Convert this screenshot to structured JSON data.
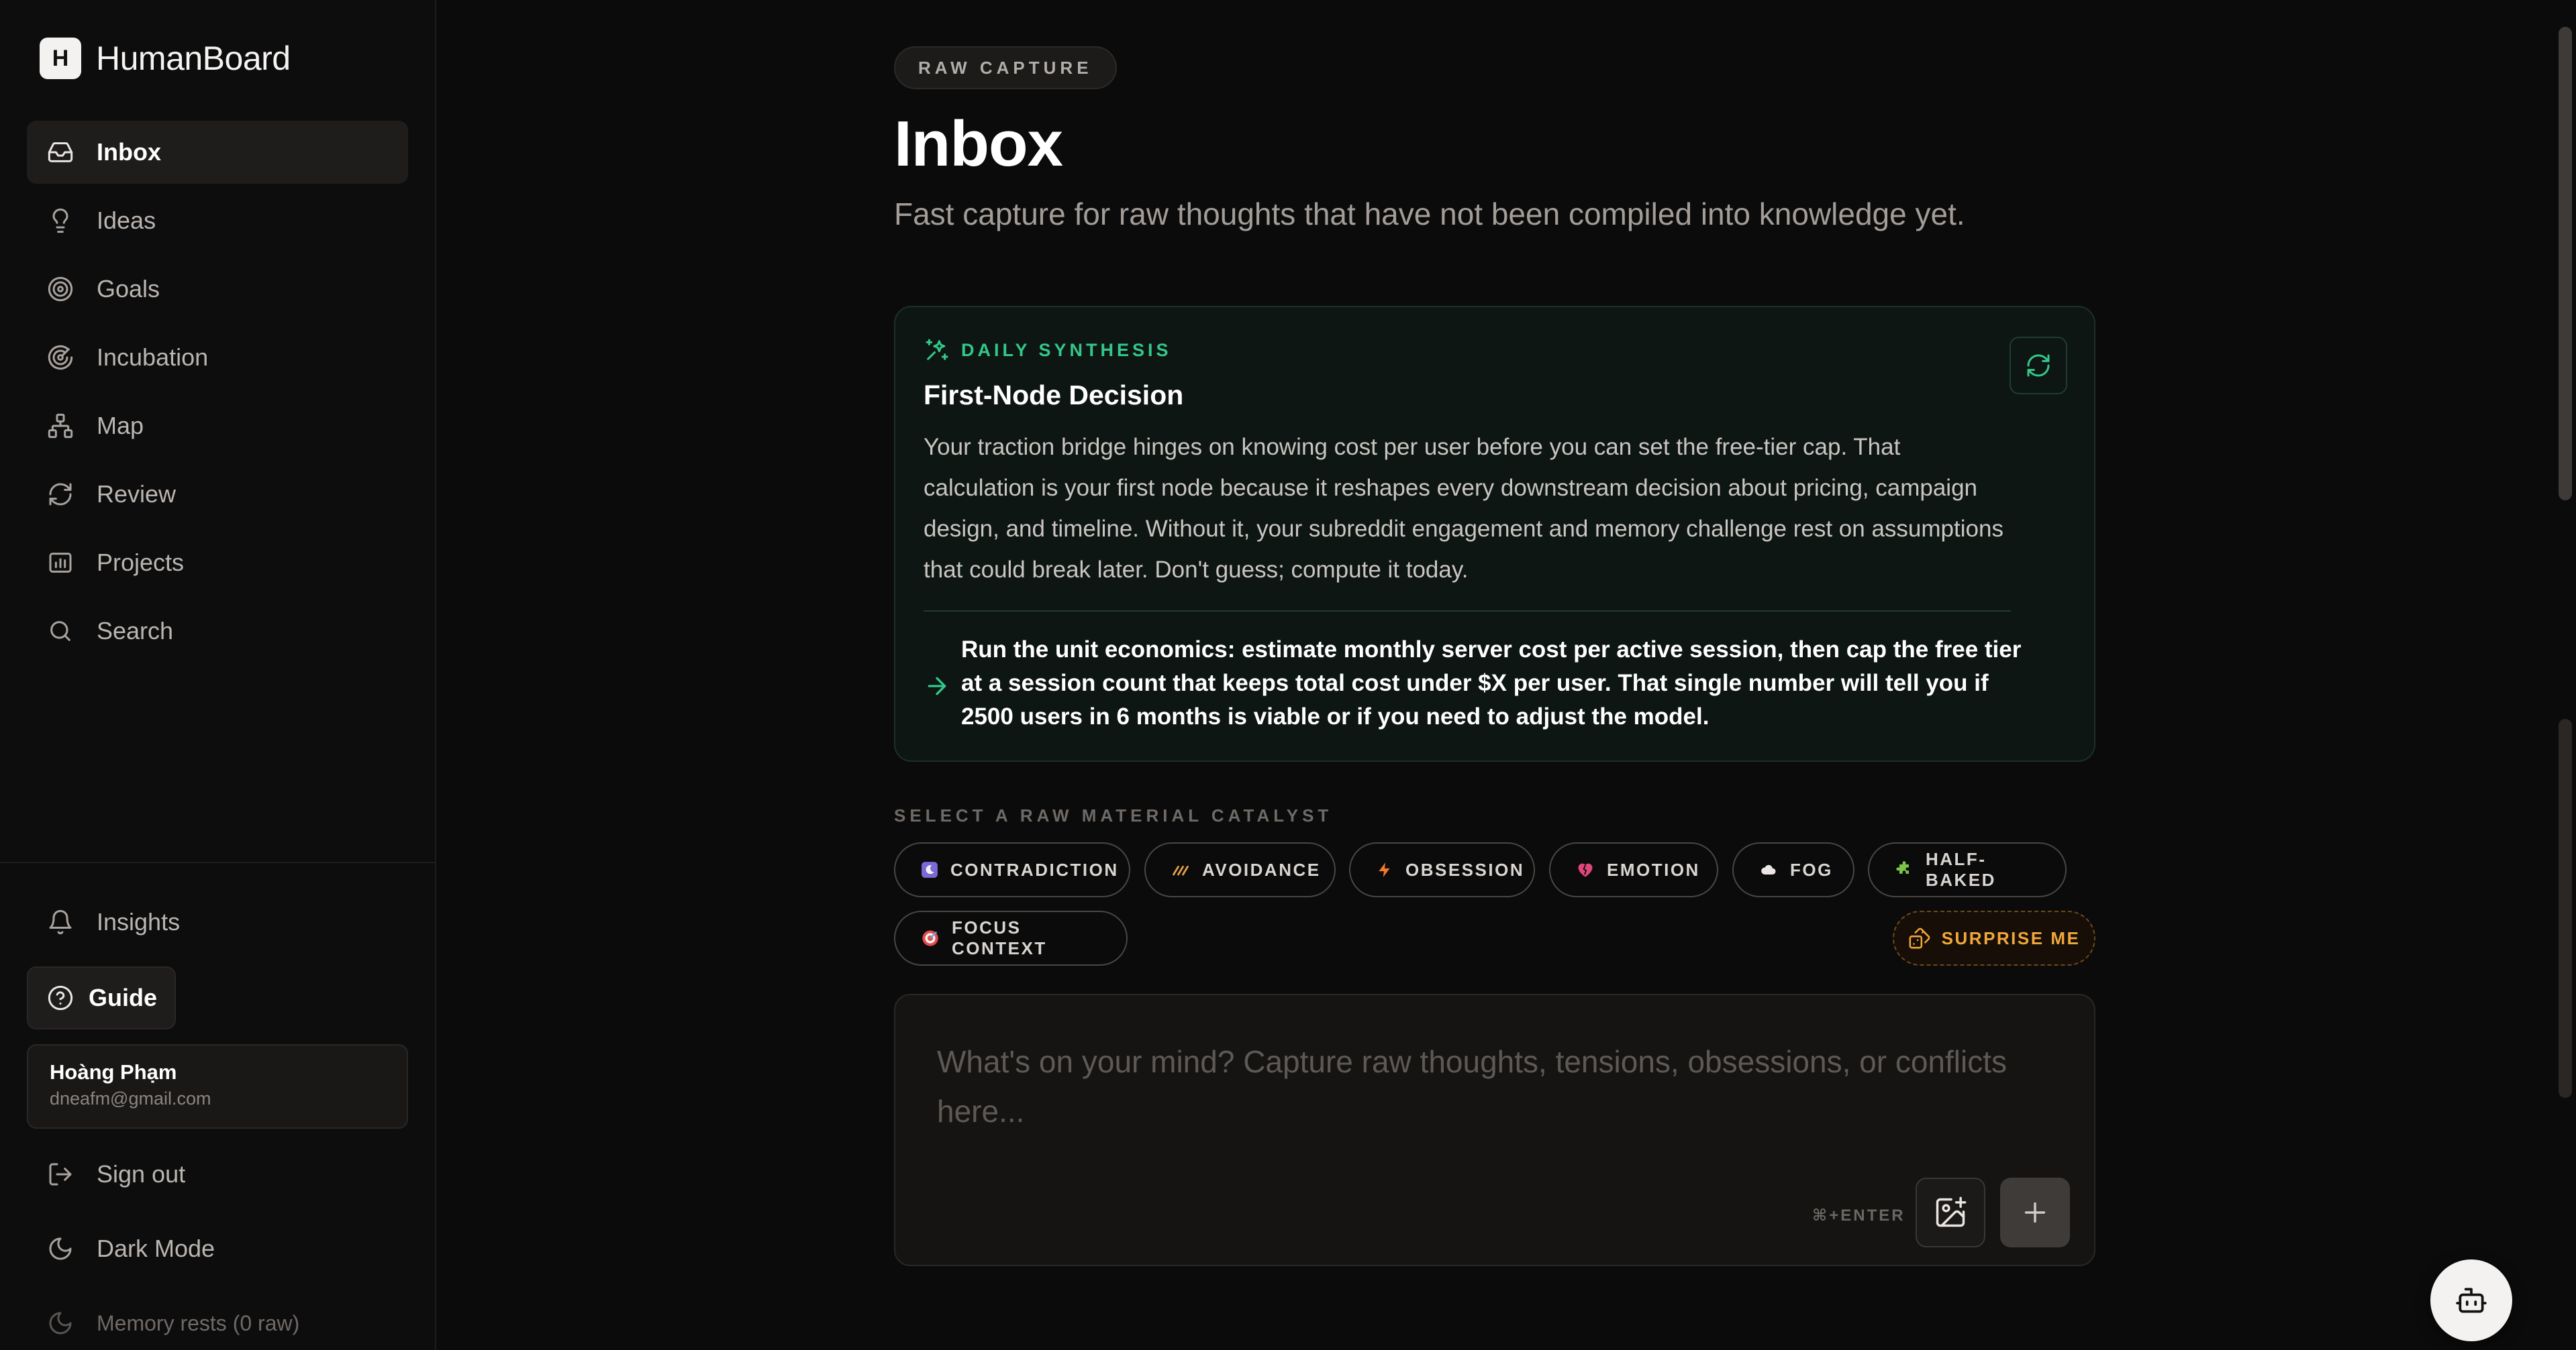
{
  "brand": {
    "logo_letter": "H",
    "name": "HumanBoard"
  },
  "sidebar": {
    "items": [
      {
        "label": "Inbox",
        "icon": "inbox-icon",
        "active": true
      },
      {
        "label": "Ideas",
        "icon": "lightbulb-icon",
        "active": false
      },
      {
        "label": "Goals",
        "icon": "target-icon",
        "active": false
      },
      {
        "label": "Incubation",
        "icon": "radar-icon",
        "active": false
      },
      {
        "label": "Map",
        "icon": "network-icon",
        "active": false
      },
      {
        "label": "Review",
        "icon": "refresh-icon",
        "active": false
      },
      {
        "label": "Projects",
        "icon": "folder-chart-icon",
        "active": false
      },
      {
        "label": "Search",
        "icon": "search-icon",
        "active": false
      }
    ],
    "insights_label": "Insights",
    "guide_label": "Guide",
    "user": {
      "name": "Hoàng Phạm",
      "email": "dneafm@gmail.com"
    },
    "sign_out_label": "Sign out",
    "dark_mode_label": "Dark Mode",
    "memory_label": "Memory rests (0 raw)"
  },
  "header": {
    "pill": "RAW CAPTURE",
    "title": "Inbox",
    "subtitle": "Fast capture for raw thoughts that have not been compiled into knowledge yet."
  },
  "synthesis": {
    "label": "DAILY SYNTHESIS",
    "title": "First-Node Decision",
    "body": "Your traction bridge hinges on knowing cost per user before you can set the free-tier cap. That calculation is your first node because it reshapes every downstream decision about pricing, campaign design, and timeline. Without it, your subreddit engagement and memory challenge rest on assumptions that could break later. Don't guess; compute it today.",
    "action": "Run the unit economics: estimate monthly server cost per active session, then cap the free tier at a session count that keeps total cost under $X per user. That single number will tell you if 2500 users in 6 months is viable or if you need to adjust the model.",
    "accent_color": "#33c88a"
  },
  "catalyst": {
    "label": "SELECT A RAW MATERIAL CATALYST",
    "chips": [
      {
        "label": "CONTRADICTION",
        "icon": "moon-icon"
      },
      {
        "label": "AVOIDANCE",
        "icon": "swerve-icon"
      },
      {
        "label": "OBSESSION",
        "icon": "bolt-icon"
      },
      {
        "label": "EMOTION",
        "icon": "broken-heart-icon"
      },
      {
        "label": "FOG",
        "icon": "cloud-icon"
      },
      {
        "label": "HALF-BAKED",
        "icon": "puzzle-icon"
      },
      {
        "label": "FOCUS CONTEXT",
        "icon": "bullseye-icon"
      }
    ],
    "surprise_label": "SURPRISE ME",
    "surprise_color": "#f1a73b"
  },
  "composer": {
    "placeholder": "What's on your mind? Capture raw thoughts, tensions, obsessions, or conflicts here...",
    "value": "",
    "shortcut": "⌘+ENTER"
  }
}
